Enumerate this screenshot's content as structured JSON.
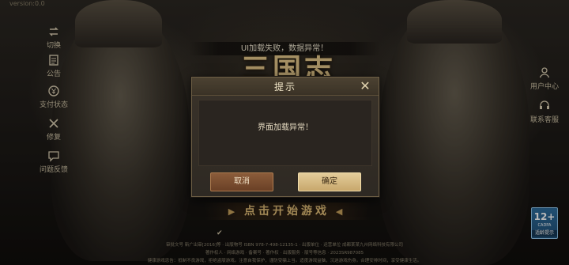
{
  "app": {
    "version": "version:0.0"
  },
  "left_menu": [
    {
      "label": "切换",
      "icon": "switch-icon"
    },
    {
      "label": "公告",
      "icon": "notice-icon"
    },
    {
      "label": "支付状态",
      "icon": "payment-status-icon"
    },
    {
      "label": "修复",
      "icon": "repair-icon"
    },
    {
      "label": "问题反馈",
      "icon": "feedback-icon"
    }
  ],
  "right_menu": [
    {
      "label": "用户中心",
      "icon": "user-center-icon"
    },
    {
      "label": "联系客服",
      "icon": "customer-service-icon"
    }
  ],
  "banner": {
    "text": "UI加载失败，数据异常！"
  },
  "logo": {
    "text": "三国志"
  },
  "dialog": {
    "title": "提示",
    "message": "界面加载异常！",
    "cancel_label": "取消",
    "ok_label": "确定"
  },
  "start": {
    "label": "点击开始游戏"
  },
  "age_rating": {
    "number": "12+",
    "sub": "CADPA",
    "tag": "适龄提示"
  },
  "footer": {
    "line1": "审批文号 新广出审[2016]等 · 出版物号 ISBN 978-7-498-12135-1 · 出版单位 · 运营单位 成都某某九州网络科技有限公司",
    "line2": "著作权人 · 网络游戏 · 备案号 · 著作权 · 出版服务 · 版号等信息 · 2023SR987085",
    "line3": "健康游戏忠告：抵制不良游戏，拒绝盗版游戏。注意自我保护，谨防受骗上当。适度游戏益脑，沉迷游戏伤身。合理安排时间，享受健康生活。"
  },
  "colors": {
    "accent_gold": "#e6c27a",
    "cancel_button": "#7a4c30",
    "ok_button": "#d6ba82"
  }
}
